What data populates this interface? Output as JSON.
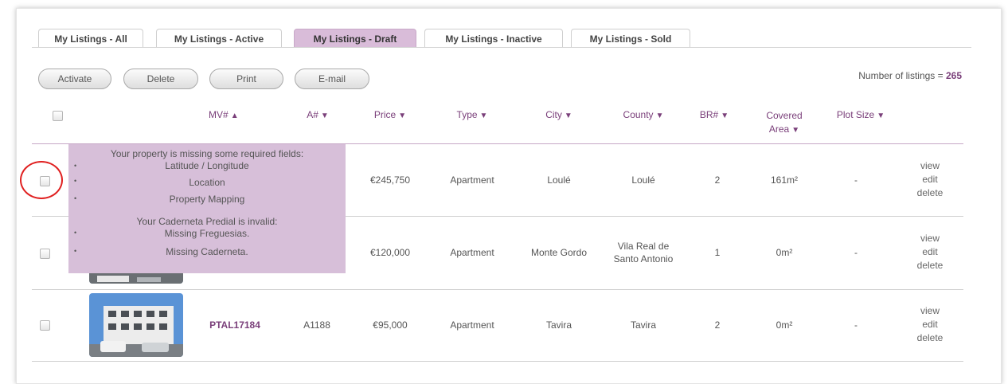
{
  "tabs": [
    {
      "label": "My Listings - All",
      "active": false
    },
    {
      "label": "My Listings - Active",
      "active": false
    },
    {
      "label": "My Listings - Draft",
      "active": true
    },
    {
      "label": "My Listings - Inactive",
      "active": false
    },
    {
      "label": "My Listings - Sold",
      "active": false
    }
  ],
  "toolbar": {
    "activate_label": "Activate",
    "delete_label": "Delete",
    "print_label": "Print",
    "email_label": "E-mail"
  },
  "listing_count": {
    "label": "Number of listings = ",
    "value": "265"
  },
  "columns": {
    "mv": "MV#",
    "mv_arrow": "▲",
    "a": "A#",
    "price": "Price",
    "type": "Type",
    "city": "City",
    "county": "County",
    "br": "BR#",
    "covered_1": "Covered",
    "covered_2": "Area",
    "plot": "Plot Size",
    "sort_arrow": "▼"
  },
  "rows": [
    {
      "mv": "",
      "a": "",
      "price": "€245,750",
      "type": "Apartment",
      "city": "Loulé",
      "county_1": "Loulé",
      "county_2": "",
      "br": "2",
      "covered": "161m²",
      "plot": "-",
      "view": "view",
      "edit": "edit",
      "delete": "delete"
    },
    {
      "mv": "",
      "a": "",
      "price": "€120,000",
      "type": "Apartment",
      "city": "Monte Gordo",
      "county_1": "Vila Real de",
      "county_2": "Santo Antonio",
      "br": "1",
      "covered": "0m²",
      "plot": "-",
      "view": "view",
      "edit": "edit",
      "delete": "delete"
    },
    {
      "mv": "PTAL17184",
      "a": "A1188",
      "price": "€95,000",
      "type": "Apartment",
      "city": "Tavira",
      "county_1": "Tavira",
      "county_2": "",
      "br": "2",
      "covered": "0m²",
      "plot": "-",
      "view": "view",
      "edit": "edit",
      "delete": "delete"
    }
  ],
  "tooltip": {
    "heading_1": "Your property is missing some required fields:",
    "missing_1": "Latitude / Longitude",
    "missing_2": "Location",
    "missing_3": "Property Mapping",
    "heading_2": "Your Caderneta Predial is invalid:",
    "invalid_1": "Missing Freguesias.",
    "invalid_2": "Missing Caderneta.",
    "bullet": "•"
  },
  "colors": {
    "accent": "#7a3f7a",
    "active_tab": "#d9bcd9",
    "tooltip_bg": "#d7bfd9",
    "highlight": "#e02020"
  }
}
